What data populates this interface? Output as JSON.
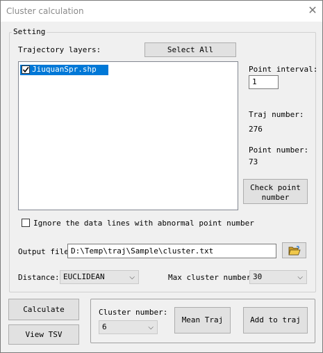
{
  "window": {
    "title": "Cluster calculation"
  },
  "setting": {
    "legend": "Setting",
    "trajectory_layers_label": "Trajectory layers:",
    "select_all_label": "Select All",
    "layers": [
      {
        "name": "JiuquanSpr.shp",
        "checked": true
      }
    ],
    "point_interval_label": "Point interval:",
    "point_interval_value": "1",
    "traj_number_label": "Traj number:",
    "traj_number_value": "276",
    "point_number_label": "Point number:",
    "point_number_value": "73",
    "check_point_label": "Check point\nnumber",
    "ignore_label": "Ignore the data lines with abnormal point number",
    "output_file_label": "Output file:",
    "output_file_value": "D:\\Temp\\traj\\Sample\\cluster.txt",
    "distance_label": "Distance:",
    "distance_value": "EUCLIDEAN",
    "max_cluster_label": "Max cluster number:",
    "max_cluster_value": "30"
  },
  "actions": {
    "calculate_label": "Calculate",
    "view_tsv_label": "View TSV",
    "cluster_number_label": "Cluster number:",
    "cluster_number_value": "6",
    "mean_traj_label": "Mean Traj",
    "add_to_traj_label": "Add to traj"
  },
  "icons": {
    "close": "close-icon",
    "folder": "folder-open-icon",
    "checkbox": "checkmark-icon",
    "dropdown": "chevron-down-icon"
  }
}
